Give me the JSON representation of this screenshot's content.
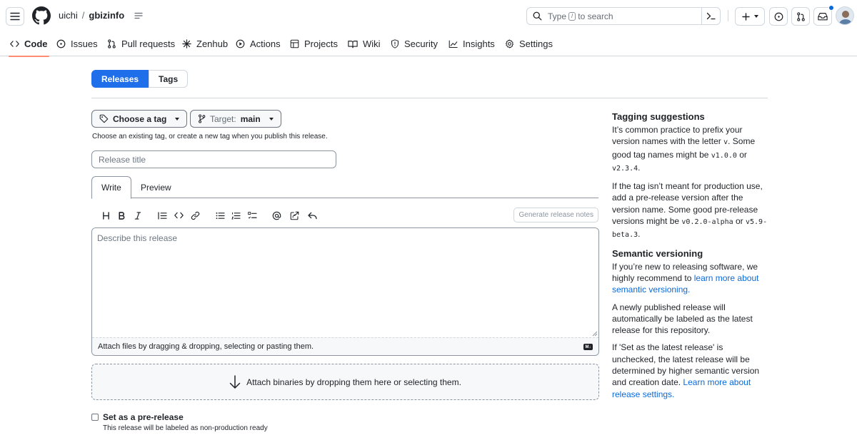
{
  "header": {
    "owner": "uichi",
    "separator": "/",
    "repo": "gbizinfo",
    "search": {
      "prefix": "Type",
      "key": "/",
      "suffix": "to search"
    }
  },
  "nav": {
    "items": [
      {
        "label": "Code",
        "icon": "code-icon"
      },
      {
        "label": "Issues",
        "icon": "issue-opened-icon"
      },
      {
        "label": "Pull requests",
        "icon": "git-pull-request-icon"
      },
      {
        "label": "Zenhub",
        "icon": "zenhub-icon"
      },
      {
        "label": "Actions",
        "icon": "play-icon"
      },
      {
        "label": "Projects",
        "icon": "table-icon"
      },
      {
        "label": "Wiki",
        "icon": "book-icon"
      },
      {
        "label": "Security",
        "icon": "shield-icon"
      },
      {
        "label": "Insights",
        "icon": "graph-icon"
      },
      {
        "label": "Settings",
        "icon": "gear-icon"
      }
    ],
    "active": "Code"
  },
  "subnav": {
    "releases": "Releases",
    "tags": "Tags"
  },
  "form": {
    "choose_tag": "Choose a tag",
    "target_prefix": "Target:",
    "target_branch": "main",
    "tag_hint": "Choose an existing tag, or create a new tag when you publish this release.",
    "title_placeholder": "Release title",
    "tab_write": "Write",
    "tab_preview": "Preview",
    "generate_notes": "Generate release notes",
    "body_placeholder": "Describe this release",
    "attach_files": "Attach files by dragging & dropping, selecting or pasting them.",
    "markdown_badge": "M↓",
    "attach_binaries": "Attach binaries by dropping them here or selecting them.",
    "prerelease_label": "Set as a pre-release",
    "prerelease_hint": "This release will be labeled as non-production ready"
  },
  "toolbar": [
    "heading-icon",
    "bold-icon",
    "italic-icon",
    "quote-icon",
    "code-icon",
    "link-icon",
    "unordered-list-icon",
    "ordered-list-icon",
    "tasklist-icon",
    "mention-icon",
    "cross-reference-icon",
    "reply-icon"
  ],
  "sidebar": {
    "tagging_title": "Tagging suggestions",
    "tagging_p1_a": "It’s common practice to prefix your version names with the letter ",
    "tagging_p1_v": "v",
    "tagging_p1_b": ". Some good tag names might be ",
    "tagging_p1_code1": "v1.0.0",
    "tagging_p1_or": " or ",
    "tagging_p1_code2": "v2.3.4",
    "tagging_p1_end": ".",
    "tagging_p2_a": "If the tag isn’t meant for production use, add a pre-release version after the version name. Some good pre-release versions might be ",
    "tagging_p2_code1": "v0.2.0-alpha",
    "tagging_p2_or": " or ",
    "tagging_p2_code2": "v5.9-beta.3",
    "tagging_p2_end": ".",
    "semver_title": "Semantic versioning",
    "semver_p1_a": "If you’re new to releasing software, we highly recommend to ",
    "semver_p1_link": "learn more about semantic versioning.",
    "semver_p2": "A newly published release will automatically be labeled as the latest release for this repository.",
    "semver_p3": "If 'Set as the latest release' is unchecked, the latest release will be determined by higher semantic version and creation date.",
    "semver_p3_link": "Learn more about release settings."
  },
  "colors": {
    "accent": "#1f6feb",
    "link": "#0969da",
    "underline": "#fd8c73",
    "notification": "#0969da"
  }
}
